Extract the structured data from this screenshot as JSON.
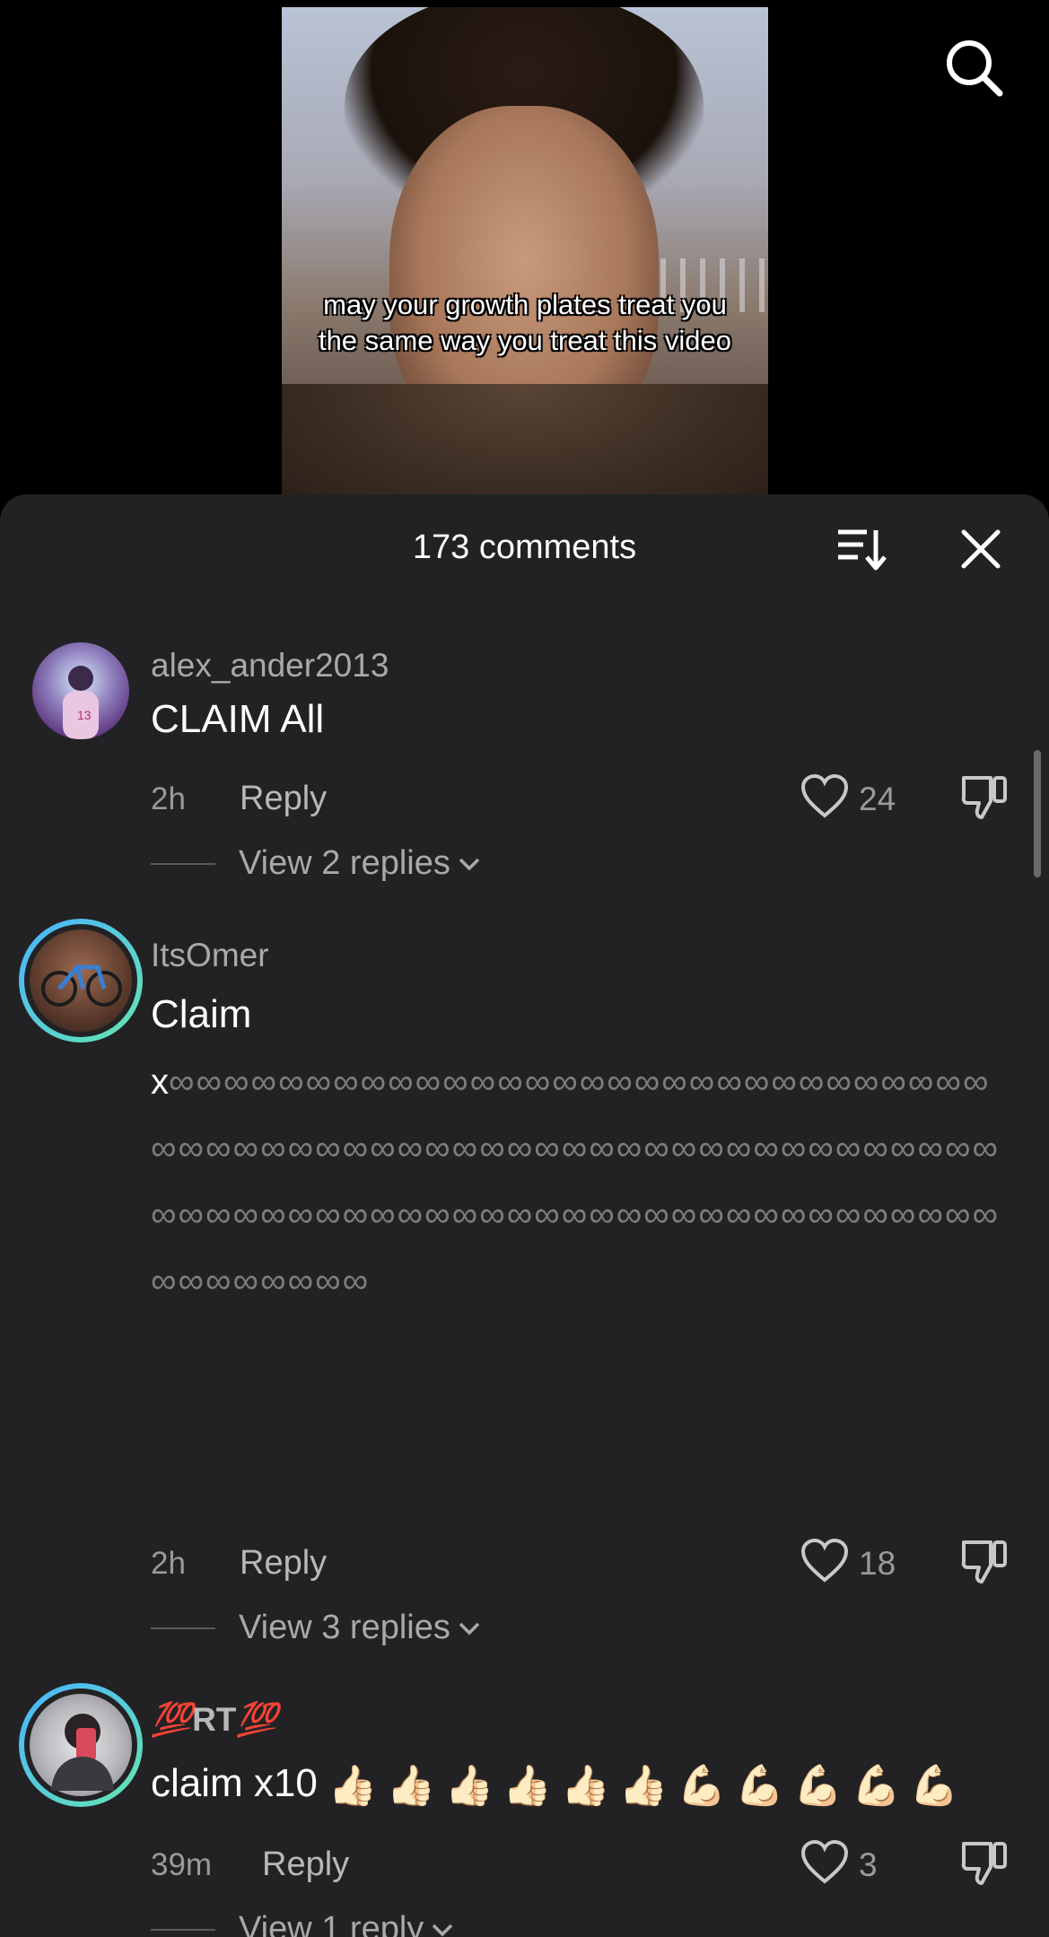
{
  "video": {
    "caption": "may your growth plates treat you the same way you treat this video"
  },
  "sheet": {
    "title": "173 comments"
  },
  "comments": [
    {
      "username": "alex_ander2013",
      "text": "CLAIM All",
      "time": "2h",
      "reply_label": "Reply",
      "likes": "24",
      "view_replies": "View 2 replies"
    },
    {
      "username": "ItsOmer",
      "text": "Claim",
      "text_line2_prefix": "x",
      "infinity_count": 100,
      "time": "2h",
      "reply_label": "Reply",
      "likes": "18",
      "view_replies": "View 3 replies"
    },
    {
      "username_prefix_emoji": "💯",
      "username": "RT",
      "username_suffix_emoji": "💯",
      "text": "claim x10",
      "emojis": [
        "👍🏻",
        "👍🏻",
        "👍🏻",
        "👍🏻",
        "👍🏻",
        "👍🏻",
        "💪🏻",
        "💪🏻",
        "💪🏻",
        "💪🏻",
        "💪🏻"
      ],
      "time": "39m",
      "reply_label": "Reply",
      "likes": "3",
      "view_replies": "View 1 reply"
    }
  ]
}
